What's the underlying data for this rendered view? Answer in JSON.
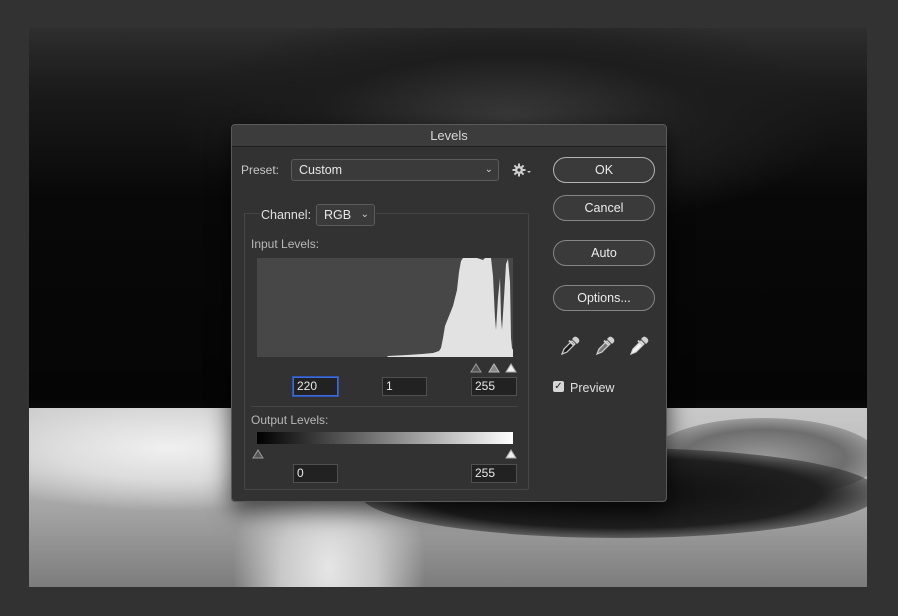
{
  "dialog": {
    "title": "Levels",
    "preset_label": "Preset:",
    "preset_value": "Custom",
    "channel_label": "Channel:",
    "channel_value": "RGB",
    "input_levels_label": "Input Levels:",
    "input_black": "220",
    "input_gamma": "1",
    "input_white": "255",
    "output_levels_label": "Output Levels:",
    "output_black": "0",
    "output_white": "255",
    "buttons": {
      "ok": "OK",
      "cancel": "Cancel",
      "auto": "Auto",
      "options": "Options..."
    },
    "preview_label": "Preview",
    "preview_checked": true
  },
  "icons": {
    "preset_options": "gear-icon",
    "eyedroppers": [
      "black-eyedropper-icon",
      "gray-eyedropper-icon",
      "white-eyedropper-icon"
    ]
  },
  "colors": {
    "dialog_bg": "#323232",
    "histogram_bg": "#474747",
    "histogram_fill": "#e2e2e2",
    "focus_ring": "#3f6ad8"
  }
}
